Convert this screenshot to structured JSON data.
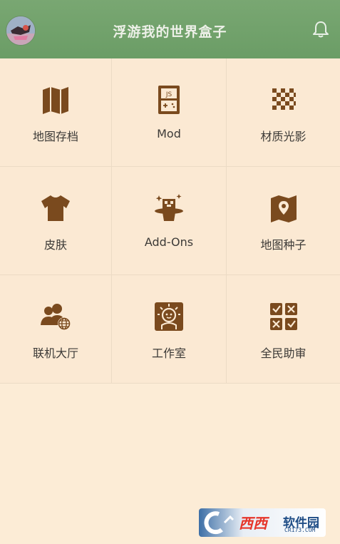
{
  "header": {
    "title": "浮游我的世界盒子",
    "avatar_icon": "avatar-image",
    "bell_icon": "bell-icon"
  },
  "grid": [
    {
      "label": "地图存档",
      "icon": "map-icon"
    },
    {
      "label": "Mod",
      "icon": "js-device-icon"
    },
    {
      "label": "材质光影",
      "icon": "checkerboard-icon"
    },
    {
      "label": "皮肤",
      "icon": "shirt-icon"
    },
    {
      "label": "Add-Ons",
      "icon": "magic-hat-icon"
    },
    {
      "label": "地图种子",
      "icon": "map-pin-icon"
    },
    {
      "label": "联机大厅",
      "icon": "people-globe-icon"
    },
    {
      "label": "工作室",
      "icon": "studio-icon"
    },
    {
      "label": "全民助审",
      "icon": "review-checks-icon"
    }
  ],
  "watermark": {
    "brand": "西西",
    "name": "软件园",
    "url": "CR173.COM"
  },
  "colors": {
    "header": "#6fa06a",
    "background": "#fcecd6",
    "icon": "#7a4a1e"
  }
}
